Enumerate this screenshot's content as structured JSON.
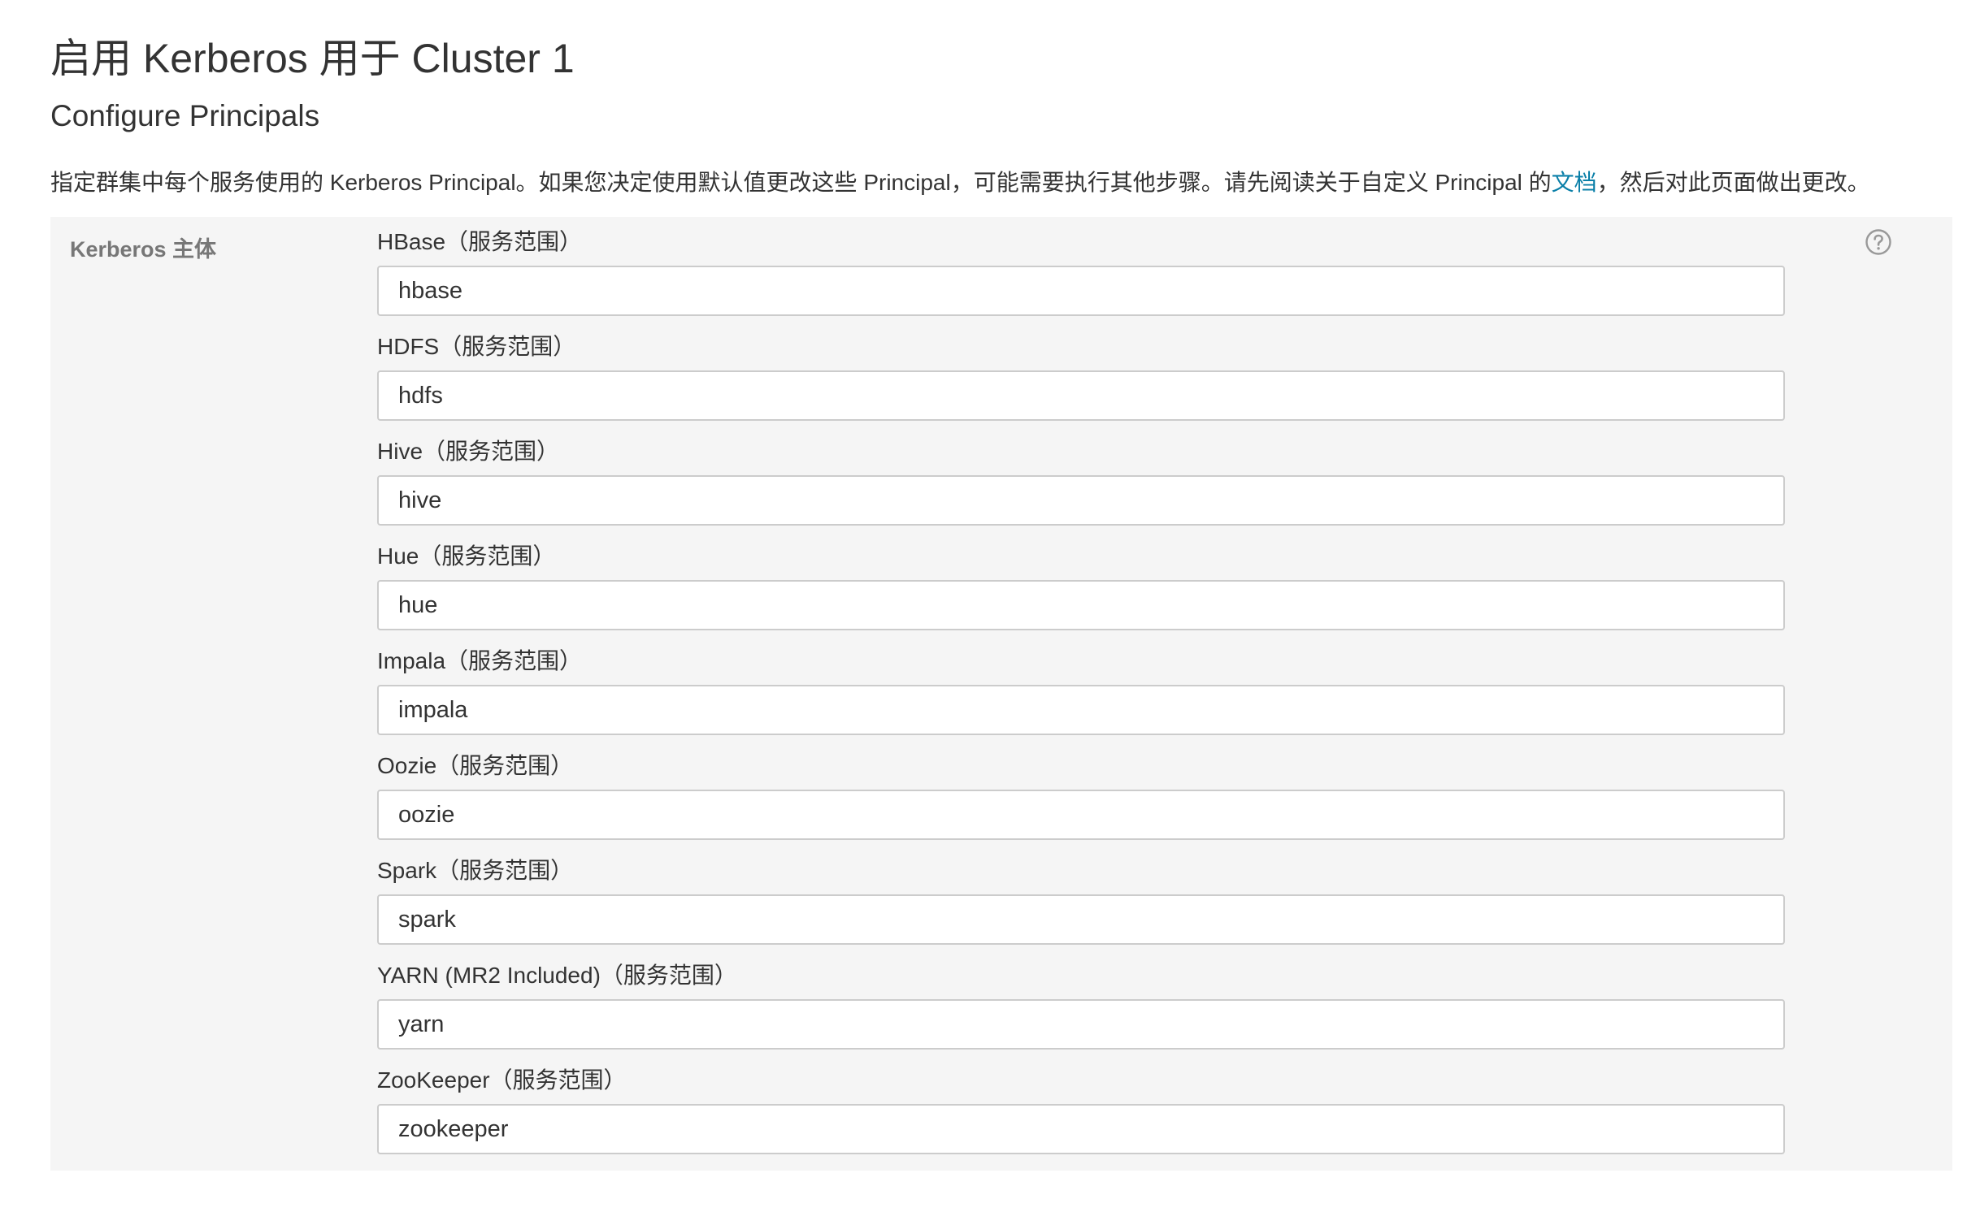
{
  "header": {
    "title": "启用 Kerberos 用于 Cluster 1",
    "subtitle": "Configure Principals"
  },
  "description": {
    "text_before": "指定群集中每个服务使用的 Kerberos Principal。如果您决定使用默认值更改这些 Principal，可能需要执行其他步骤。请先阅读关于自定义 Principal 的",
    "link_text": "文档",
    "text_after": "，然后对此页面做出更改。",
    "link_color": "#0a7fa8"
  },
  "panel": {
    "label": "Kerberos 主体",
    "help_icon": "question-circle-icon",
    "fields": [
      {
        "label": "HBase（服务范围）",
        "value": "hbase"
      },
      {
        "label": "HDFS（服务范围）",
        "value": "hdfs"
      },
      {
        "label": "Hive（服务范围）",
        "value": "hive"
      },
      {
        "label": "Hue（服务范围）",
        "value": "hue"
      },
      {
        "label": "Impala（服务范围）",
        "value": "impala"
      },
      {
        "label": "Oozie（服务范围）",
        "value": "oozie"
      },
      {
        "label": "Spark（服务范围）",
        "value": "spark"
      },
      {
        "label": "YARN (MR2 Included)（服务范围）",
        "value": "yarn"
      },
      {
        "label": "ZooKeeper（服务范围）",
        "value": "zookeeper"
      }
    ]
  }
}
